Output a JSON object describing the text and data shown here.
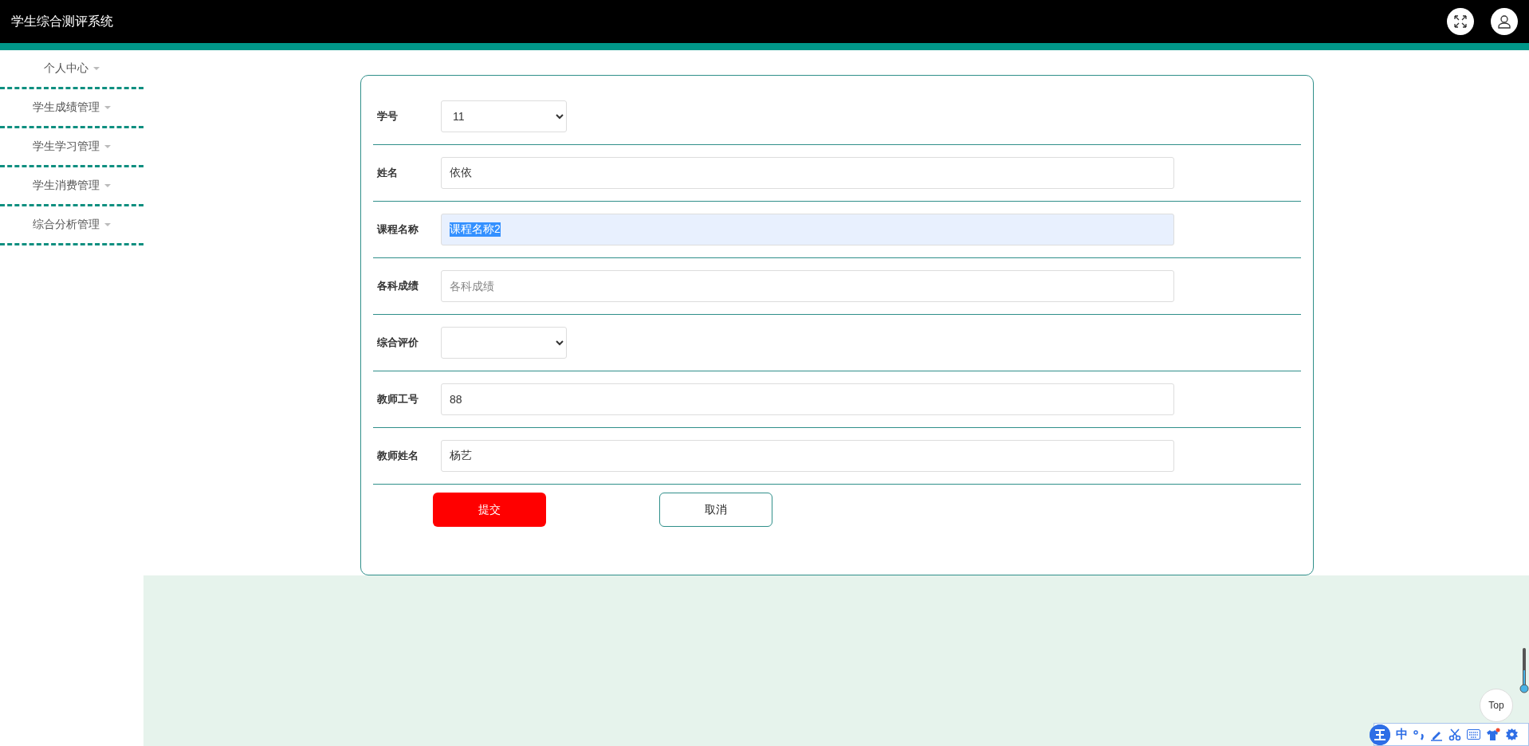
{
  "header": {
    "title": "学生综合测评系统"
  },
  "sidebar": {
    "items": [
      {
        "label": "个人中心"
      },
      {
        "label": "学生成绩管理"
      },
      {
        "label": "学生学习管理"
      },
      {
        "label": "学生消费管理"
      },
      {
        "label": "综合分析管理"
      }
    ]
  },
  "form": {
    "fields": [
      {
        "kind": "select",
        "label": "学号",
        "value": "11",
        "highlighted": false
      },
      {
        "kind": "input",
        "label": "姓名",
        "value": "依依",
        "highlighted": false
      },
      {
        "kind": "input",
        "label": "课程名称",
        "value": "课程名称2",
        "highlighted": true
      },
      {
        "kind": "input",
        "label": "各科成绩",
        "placeholder": "各科成绩",
        "highlighted": false
      },
      {
        "kind": "select",
        "label": "综合评价",
        "highlighted": false
      },
      {
        "kind": "input",
        "label": "教师工号",
        "value": "88",
        "highlighted": false
      },
      {
        "kind": "input",
        "label": "教师姓名",
        "value": "杨艺",
        "highlighted": false
      }
    ],
    "buttons": [
      {
        "kind": "submit",
        "label": "提交"
      },
      {
        "kind": "cancel",
        "label": "取消"
      }
    ]
  },
  "back_to_top": {
    "label": "Top"
  },
  "ime_toolbar": {
    "mode": "中"
  }
}
